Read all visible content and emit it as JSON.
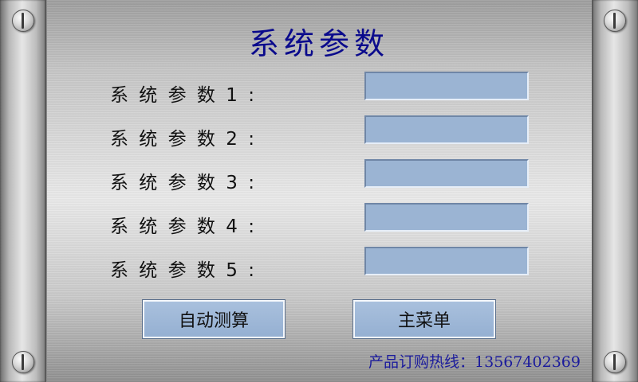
{
  "title": "系统参数",
  "params": [
    {
      "label": "系 统 参 数 1 :",
      "value": ""
    },
    {
      "label": "系 统 参 数 2 :",
      "value": ""
    },
    {
      "label": "系 统 参 数 3 :",
      "value": ""
    },
    {
      "label": "系 统 参 数 4 :",
      "value": ""
    },
    {
      "label": "系 统 参 数 5 :",
      "value": ""
    }
  ],
  "buttons": {
    "auto_calc": "自动测算",
    "main_menu": "主菜单"
  },
  "hotline": "产品订购热线：13567402369",
  "colors": {
    "title": "#0a0a8c",
    "field_fill": "#9bb4d3",
    "button_fill": "#95b0d2",
    "hotline": "#1b1b9c"
  }
}
